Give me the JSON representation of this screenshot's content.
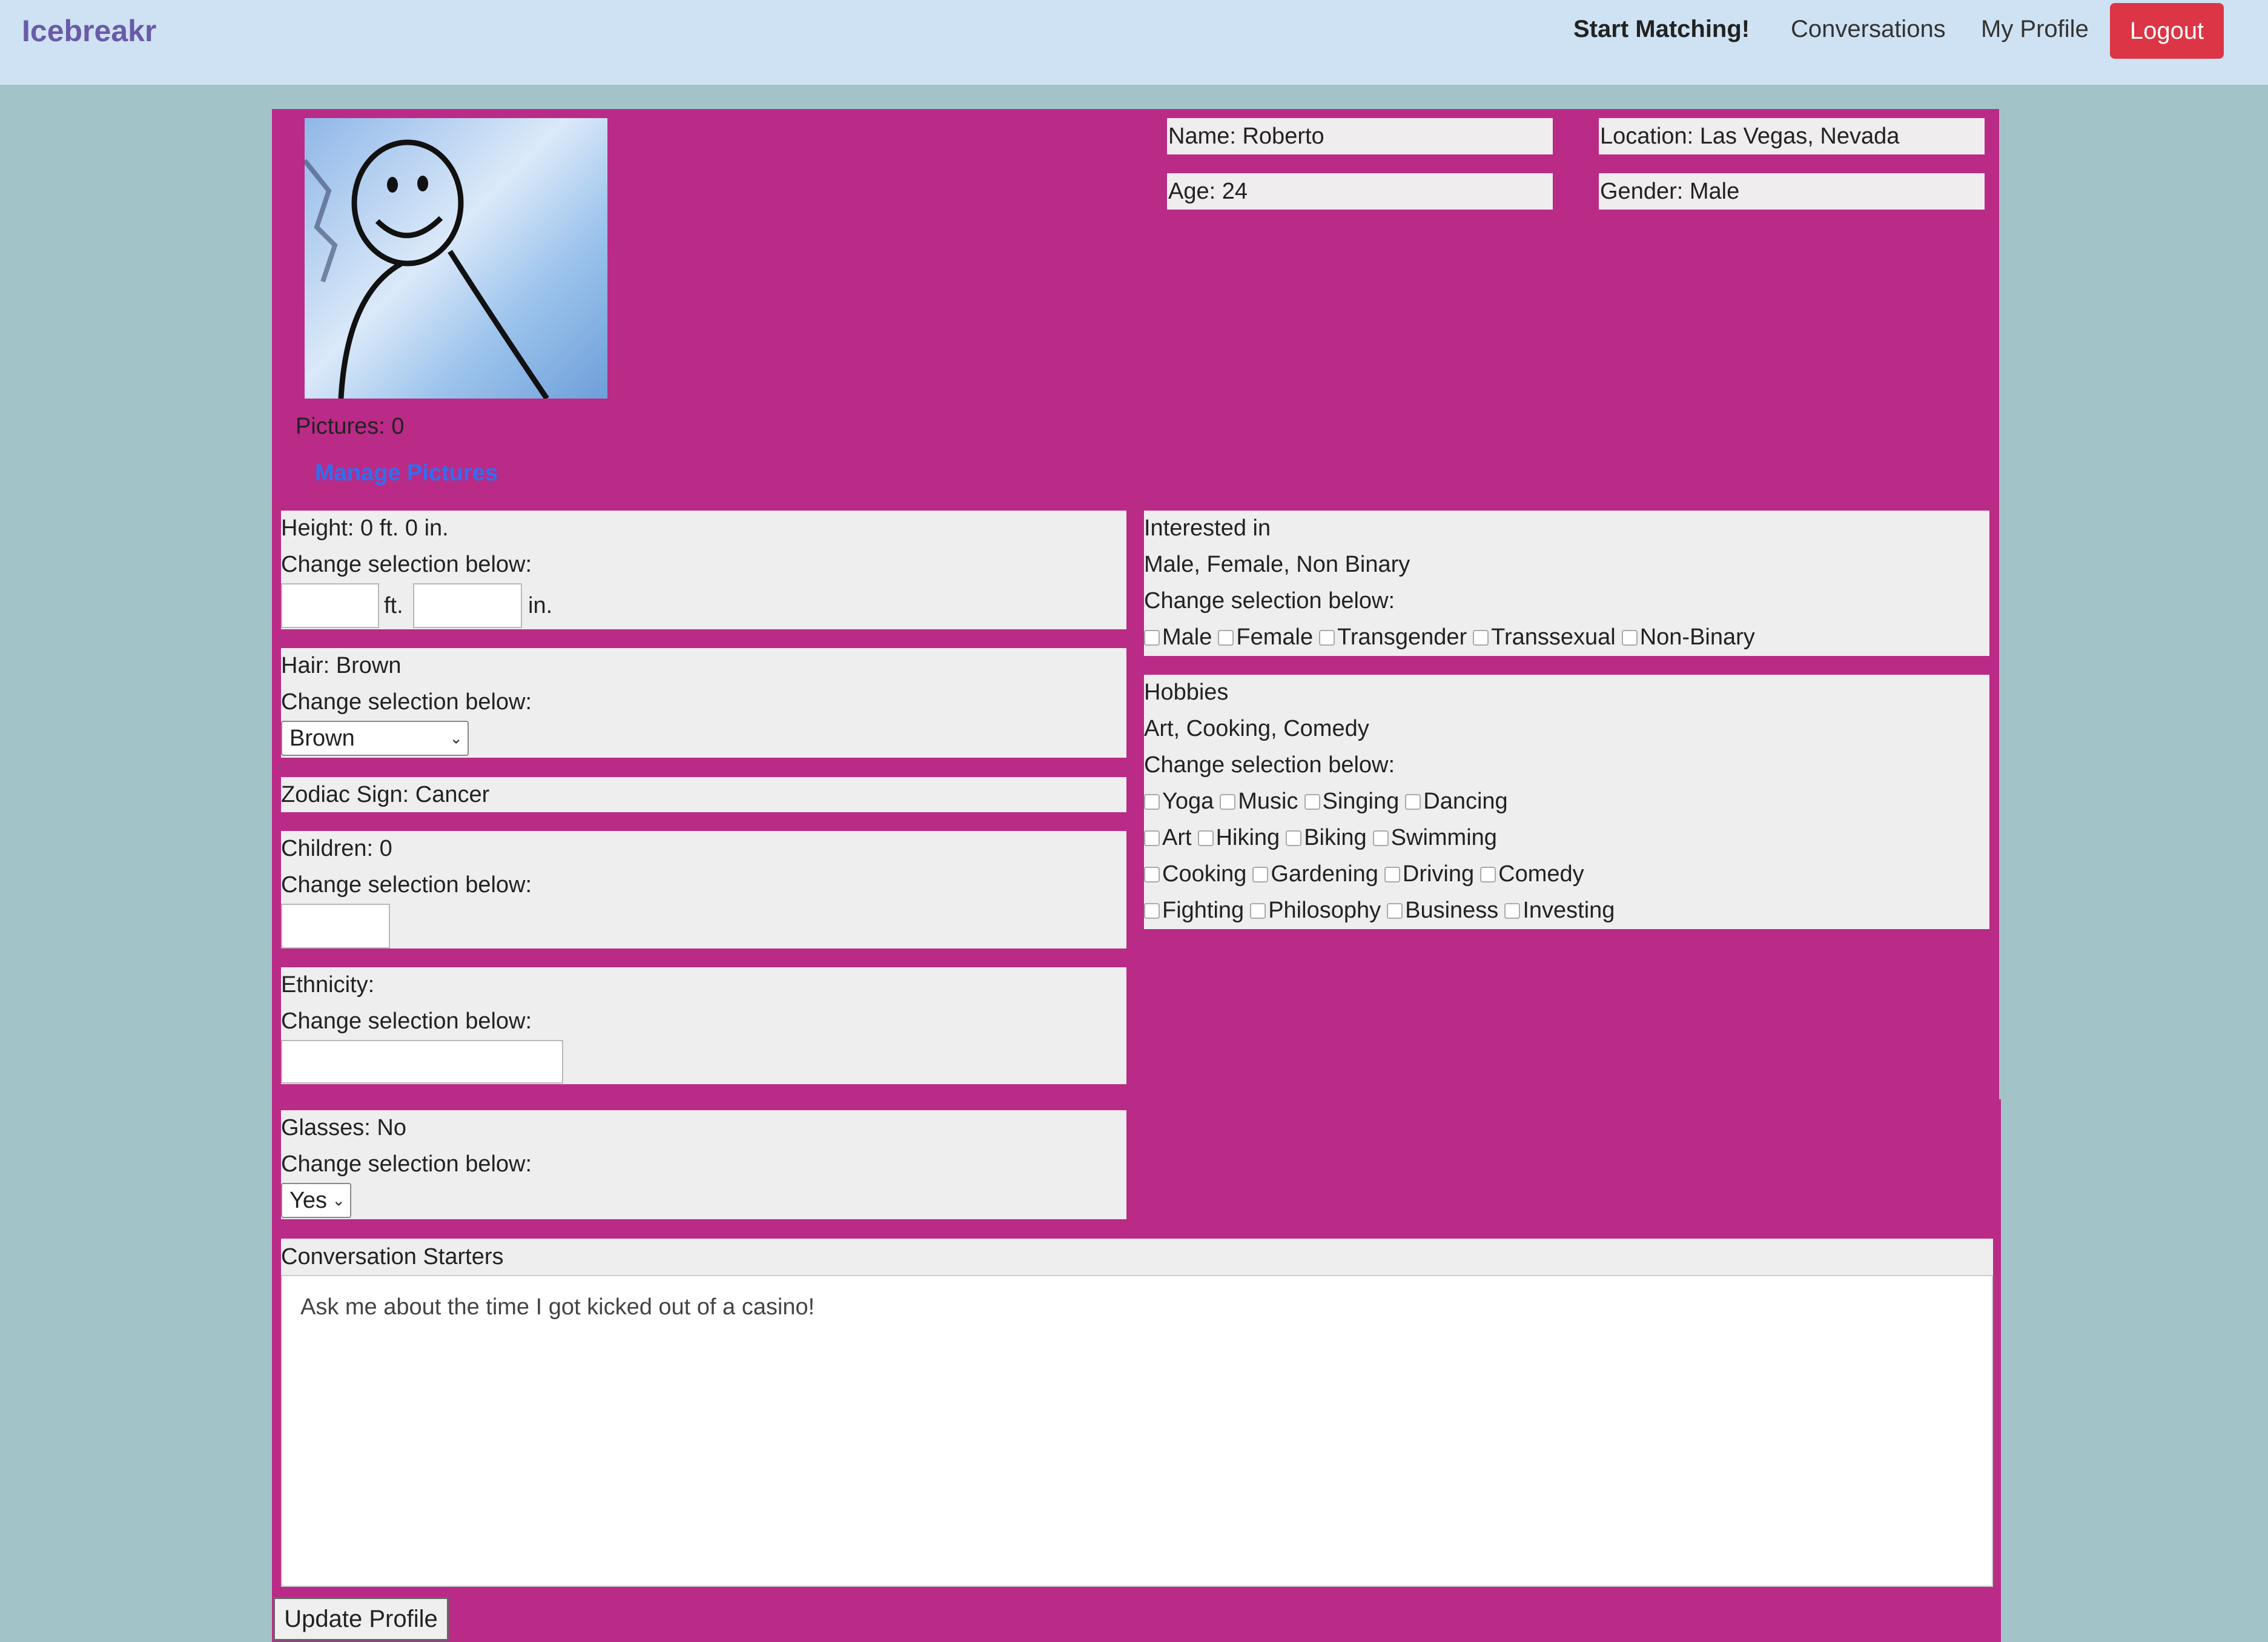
{
  "nav": {
    "brand": "Icebreakr",
    "links": {
      "start_matching": "Start Matching!",
      "conversations": "Conversations",
      "my_profile": "My Profile"
    },
    "logout": "Logout"
  },
  "profile": {
    "pictures_label": "Pictures: 0",
    "manage_pictures": "Manage Pictures",
    "name": "Name: Roberto",
    "location": "Location: Las Vegas, Nevada",
    "age": "Age: 24",
    "gender": "Gender: Male"
  },
  "change_label": "Change selection below:",
  "height": {
    "label": "Height: 0 ft. 0 in.",
    "ft_unit": "ft.",
    "in_unit": "in."
  },
  "hair": {
    "label": "Hair: Brown",
    "selected": "Brown"
  },
  "zodiac": {
    "label": "Zodiac Sign: Cancer"
  },
  "children": {
    "label": "Children: 0"
  },
  "ethnicity": {
    "label": "Ethnicity:"
  },
  "glasses": {
    "label": "Glasses: No",
    "selected": "Yes"
  },
  "interested": {
    "title": "Interested in",
    "value": "Male, Female, Non Binary",
    "options": [
      "Male",
      "Female",
      "Transgender",
      "Transsexual",
      "Non-Binary"
    ]
  },
  "hobbies": {
    "title": "Hobbies",
    "value": "Art, Cooking, Comedy",
    "rows": [
      [
        "Yoga",
        "Music",
        "Singing",
        "Dancing"
      ],
      [
        "Art",
        "Hiking",
        "Biking",
        "Swimming"
      ],
      [
        "Cooking",
        "Gardening",
        "Driving",
        "Comedy"
      ],
      [
        "Fighting",
        "Philosophy",
        "Business",
        "Investing"
      ]
    ]
  },
  "conversation": {
    "title": "Conversation Starters",
    "text": "Ask me about the time I got kicked out of a casino!"
  },
  "update_button": "Update Profile",
  "colors": {
    "card": "#b92b87",
    "background": "#a2c4c9",
    "navbar": "#cfe2f3",
    "logout": "#dc3545",
    "brand": "#6a5aa8",
    "link": "#2f6ff0"
  }
}
